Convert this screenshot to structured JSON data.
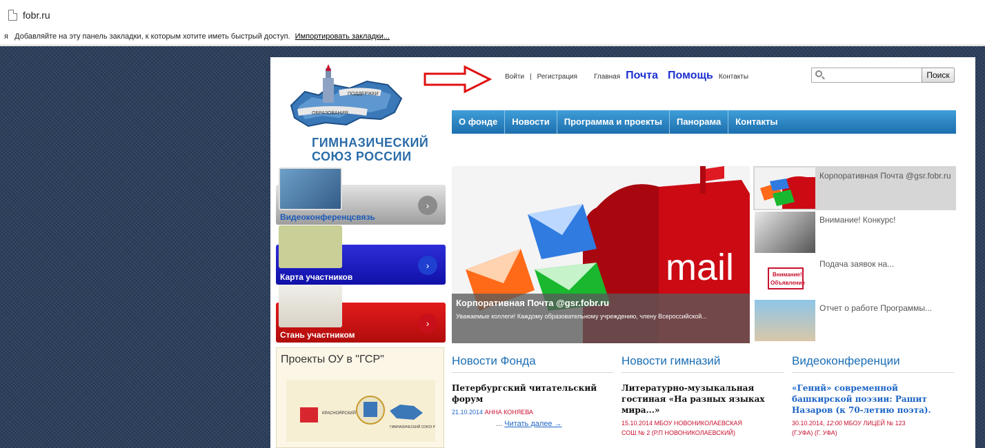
{
  "browser": {
    "tab_title": "fobr.ru",
    "bookmarks_prefix": "я",
    "bookmarks_text": "Добавляйте на эту панель закладки, к которым хотите иметь быстрый доступ.",
    "bookmarks_import": "Импортировать закладки..."
  },
  "header": {
    "logo_line1": "ГИМНАЗИЧЕСКИЙ",
    "logo_line2": "СОЮЗ РОССИИ",
    "logo_ribbon1": "ПОДДЕРЖКИ",
    "logo_ribbon2": "ОБРАЗОВАНИЯ",
    "login": "Войти",
    "separator": "|",
    "register": "Регистрация",
    "home": "Главная",
    "mail": "Почта",
    "help": "Помощь",
    "contacts": "Контакты",
    "search_button": "Поиск",
    "search_value": ""
  },
  "nav": {
    "items": [
      "О фонде",
      "Новости",
      "Программа и проекты",
      "Панорама",
      "Контакты"
    ]
  },
  "side": {
    "video": "Видеоконференцсвязь",
    "map": "Карта участников",
    "join": "Стань участником",
    "projects_title": "Проекты ОУ в \"ГСР\"",
    "proj_institute": "КРАСНОЯРСКИЙ ИНСТИТУТ",
    "proj_union": "ГИМНАЗИЧЕСКИЙ СОЮЗ РОССИИ"
  },
  "slider": {
    "caption_title": "Корпоративная Почта @gsr.fobr.ru",
    "caption_text": "Уважаемые коллеги! Каждому образовательному учреждению, члену Всероссийской...",
    "mail_word": "mail",
    "thumbs": [
      {
        "title": "Корпоративная Почта @gsr.fobr.ru"
      },
      {
        "title": "Внимание! Конкурс!"
      },
      {
        "title": "Подача заявок на..."
      },
      {
        "title": "Отчет о работе Программы..."
      }
    ],
    "notice_line1": "Внимание!",
    "notice_line2": "Объявление"
  },
  "news": {
    "fund": {
      "title": "Новости Фонда",
      "article": "Петербургский читательский форум",
      "date": "21.10.2014",
      "author": "АННА КОНЯЕВА",
      "more_prefix": "...",
      "more": "Читать далее →"
    },
    "gymnasium": {
      "title": "Новости гимназий",
      "article": "Литературно-музыкальная гостиная «На разных языках мира...»",
      "date": "15.10.2014",
      "author": "МБОУ НОВОНИКОЛАЕВСКАЯ",
      "cut": "СОШ № 2 (Р.П НОВОНИКОЛАЕВСКИЙ)"
    },
    "video": {
      "title": "Видеоконференции",
      "article": "«Гений» современной башкирской поэзии: Рашит Назаров (к 70-летию поэта).",
      "date": "30.10.2014,",
      "time": "12:00",
      "author": "МБОУ ЛИЦЕЙ № 123",
      "cut": "(Г.УФА) (Г. УФА)"
    }
  },
  "colors": {
    "page_bg": "#2b3f5c",
    "nav_blue": "#1d6fae",
    "mail_red": "#cc0a14",
    "link_blue": "#1a2fd0",
    "accent_red": "#c8102e"
  }
}
